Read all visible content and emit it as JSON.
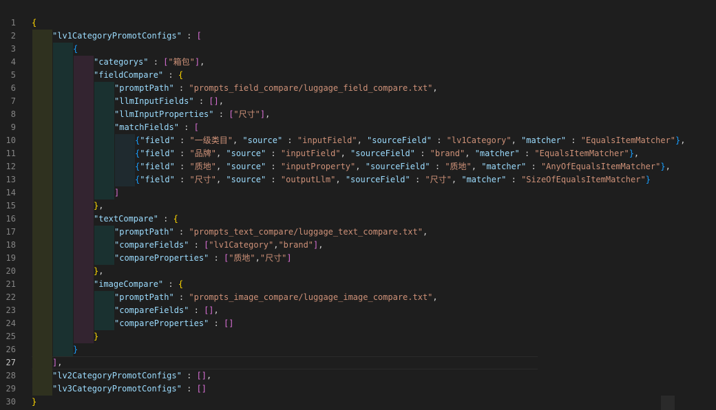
{
  "editor": {
    "language": "json",
    "active_line": "27",
    "colors": {
      "background": "#1e1e1e",
      "key": "#9cdcfe",
      "string": "#ce9178",
      "punctuation": "#d4d4d4",
      "bracket_level_1": "#ffd700",
      "bracket_level_2": "#da70d6",
      "bracket_level_3": "#179fff",
      "line_number": "#858585"
    },
    "line_numbers": [
      "1",
      "2",
      "3",
      "4",
      "5",
      "6",
      "7",
      "8",
      "9",
      "10",
      "11",
      "12",
      "13",
      "14",
      "15",
      "16",
      "17",
      "18",
      "19",
      "20",
      "21",
      "22",
      "23",
      "24",
      "25",
      "26",
      "27",
      "28",
      "29",
      "30"
    ],
    "lines": {
      "l1": {
        "t1": "{"
      },
      "l2": {
        "k1": "\"lv1CategoryPromotConfigs\"",
        "p1": " : ",
        "t2": "["
      },
      "l3": {
        "t3": "{"
      },
      "l4": {
        "k1": "\"categorys\"",
        "p1": " : ",
        "b1": "[",
        "s1": "\"箱包\"",
        "b2": "]",
        "p2": ","
      },
      "l5": {
        "k1": "\"fieldCompare\"",
        "p1": " : ",
        "b1": "{"
      },
      "l6": {
        "k1": "\"promptPath\"",
        "p1": " : ",
        "s1": "\"prompts_field_compare/luggage_field_compare.txt\"",
        "p2": ","
      },
      "l7": {
        "k1": "\"llmInputFields\"",
        "p1": " : ",
        "b1": "[",
        "b2": "]",
        "p2": ","
      },
      "l8": {
        "k1": "\"llmInputProperties\"",
        "p1": " : ",
        "b1": "[",
        "s1": "\"尺寸\"",
        "b2": "]",
        "p2": ","
      },
      "l9": {
        "k1": "\"matchFields\"",
        "p1": " : ",
        "b1": "["
      },
      "l10": {
        "b1": "{",
        "k1": "\"field\"",
        "p1": " : ",
        "s1": "\"一级类目\"",
        "p2": ", ",
        "k2": "\"source\"",
        "p3": " : ",
        "s2": "\"inputField\"",
        "p4": ", ",
        "k3": "\"sourceField\"",
        "p5": " : ",
        "s3": "\"lv1Category\"",
        "p6": ", ",
        "k4": "\"matcher\"",
        "p7": " : ",
        "s4": "\"EqualsItemMatcher\"",
        "b2": "}",
        "p8": ","
      },
      "l11": {
        "b1": "{",
        "k1": "\"field\"",
        "p1": " : ",
        "s1": "\"品牌\"",
        "p2": ", ",
        "k2": "\"source\"",
        "p3": " : ",
        "s2": "\"inputField\"",
        "p4": ", ",
        "k3": "\"sourceField\"",
        "p5": " : ",
        "s3": "\"brand\"",
        "p6": ", ",
        "k4": "\"matcher\"",
        "p7": " : ",
        "s4": "\"EqualsItemMatcher\"",
        "b2": "}",
        "p8": ","
      },
      "l12": {
        "b1": "{",
        "k1": "\"field\"",
        "p1": " : ",
        "s1": "\"质地\"",
        "p2": ", ",
        "k2": "\"source\"",
        "p3": " : ",
        "s2": "\"inputProperty\"",
        "p4": ", ",
        "k3": "\"sourceField\"",
        "p5": " : ",
        "s3": "\"质地\"",
        "p6": ", ",
        "k4": "\"matcher\"",
        "p7": " : ",
        "s4": "\"AnyOfEqualsItemMatcher\"",
        "b2": "}",
        "p8": ","
      },
      "l13": {
        "b1": "{",
        "k1": "\"field\"",
        "p1": " : ",
        "s1": "\"尺寸\"",
        "p2": ", ",
        "k2": "\"source\"",
        "p3": " : ",
        "s2": "\"outputLlm\"",
        "p4": ", ",
        "k3": "\"sourceField\"",
        "p5": " : ",
        "s3": "\"尺寸\"",
        "p6": ", ",
        "k4": "\"matcher\"",
        "p7": " : ",
        "s4": "\"SizeOfEqualsItemMatcher\"",
        "b2": "}"
      },
      "l14": {
        "b1": "]"
      },
      "l15": {
        "b1": "}",
        "p1": ","
      },
      "l16": {
        "k1": "\"textCompare\"",
        "p1": " : ",
        "b1": "{"
      },
      "l17": {
        "k1": "\"promptPath\"",
        "p1": " : ",
        "s1": "\"prompts_text_compare/luggage_text_compare.txt\"",
        "p2": ","
      },
      "l18": {
        "k1": "\"compareFields\"",
        "p1": " : ",
        "b1": "[",
        "s1": "\"lv1Category\"",
        "p2": ",",
        "s2": "\"brand\"",
        "b2": "]",
        "p3": ","
      },
      "l19": {
        "k1": "\"compareProperties\"",
        "p1": " : ",
        "b1": "[",
        "s1": "\"质地\"",
        "p2": ",",
        "s2": "\"尺寸\"",
        "b2": "]"
      },
      "l20": {
        "b1": "}",
        "p1": ","
      },
      "l21": {
        "k1": "\"imageCompare\"",
        "p1": " : ",
        "b1": "{"
      },
      "l22": {
        "k1": "\"promptPath\"",
        "p1": " : ",
        "s1": "\"prompts_image_compare/luggage_image_compare.txt\"",
        "p2": ","
      },
      "l23": {
        "k1": "\"compareFields\"",
        "p1": " : ",
        "b1": "[",
        "b2": "]",
        "p2": ","
      },
      "l24": {
        "k1": "\"compareProperties\"",
        "p1": " : ",
        "b1": "[",
        "b2": "]"
      },
      "l25": {
        "b1": "}"
      },
      "l26": {
        "b1": "}"
      },
      "l27": {
        "b1": "]",
        "p1": ","
      },
      "l28": {
        "k1": "\"lv2CategoryPromotConfigs\"",
        "p1": " : ",
        "b1": "[",
        "b2": "]",
        "p2": ","
      },
      "l29": {
        "k1": "\"lv3CategoryPromotConfigs\"",
        "p1": " : ",
        "b1": "[",
        "b2": "]"
      },
      "l30": {
        "b1": "}"
      }
    }
  }
}
